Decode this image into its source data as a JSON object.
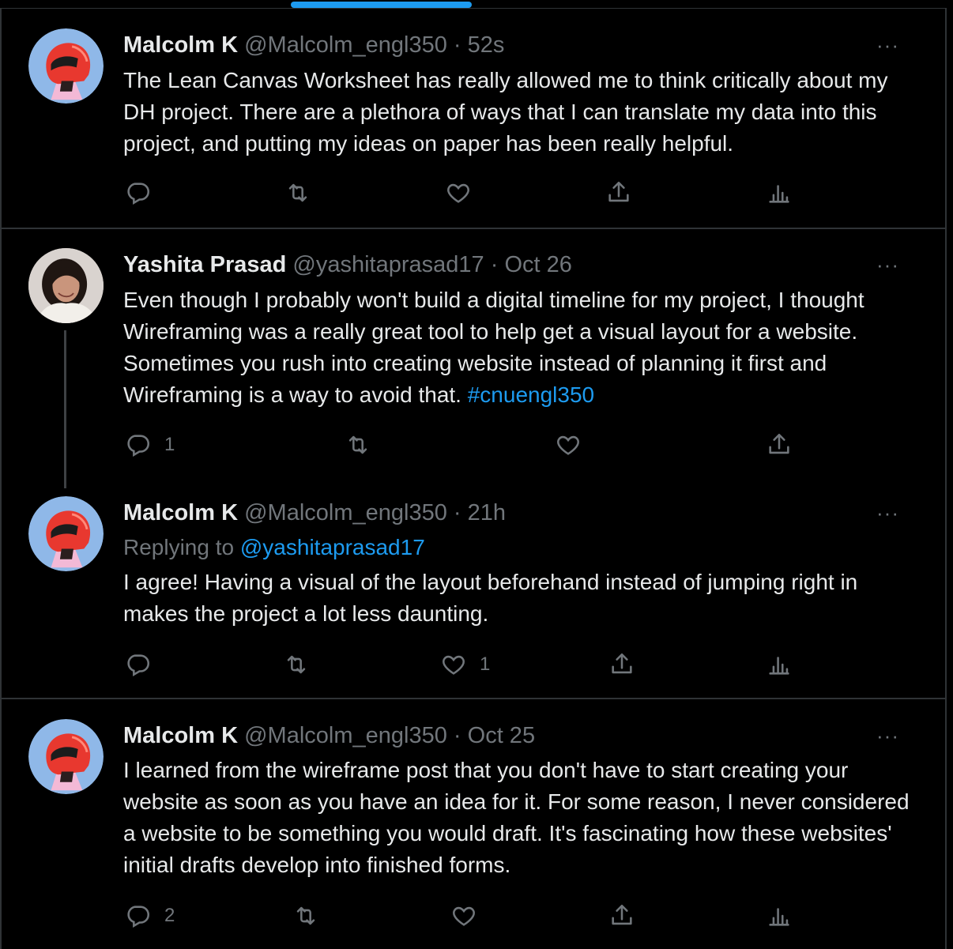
{
  "tweets": [
    {
      "name": "Malcolm K",
      "handle": "@Malcolm_engl350",
      "dot": "·",
      "time": "52s",
      "more": "···",
      "text": "The Lean Canvas Worksheet has really allowed me to think critically about my DH project. There are a plethora of ways that I can translate my data into this project, and putting my ideas on paper has been really helpful.",
      "reply_count": "",
      "retweet_count": "",
      "like_count": ""
    },
    {
      "name": "Yashita Prasad",
      "handle": "@yashitaprasad17",
      "dot": "·",
      "time": "Oct 26",
      "more": "···",
      "text": "Even though I probably won't build a digital timeline for my project, I thought Wireframing was a really great tool to help get a visual layout for a website. Sometimes you rush into creating website instead of planning it first and Wireframing is a way to avoid that.",
      "hashtag": "#cnuengl350",
      "reply_count": "1",
      "retweet_count": "",
      "like_count": ""
    },
    {
      "name": "Malcolm K",
      "handle": "@Malcolm_engl350",
      "dot": "·",
      "time": "21h",
      "more": "···",
      "replying_prefix": "Replying to",
      "replying_to": "@yashitaprasad17",
      "text": "I agree! Having a visual of the layout beforehand instead of jumping right in makes the project a lot less daunting.",
      "reply_count": "",
      "retweet_count": "",
      "like_count": "1"
    },
    {
      "name": "Malcolm K",
      "handle": "@Malcolm_engl350",
      "dot": "·",
      "time": "Oct 25",
      "more": "···",
      "text": "I learned from the wireframe post that you don't have to start creating your website as soon as you have an idea for it. For some reason, I never considered a website to be something you would draft. It's fascinating how these websites' initial drafts develop into finished forms.",
      "reply_count": "2",
      "retweet_count": "",
      "like_count": ""
    }
  ],
  "icons": {
    "reply": "reply-icon",
    "retweet": "retweet-icon",
    "like": "heart-icon",
    "share": "share-icon",
    "analytics": "analytics-icon"
  },
  "colors": {
    "background": "#000000",
    "text": "#e7e9ea",
    "muted": "#71767b",
    "link": "#1d9bf0",
    "border": "#2f3336"
  }
}
